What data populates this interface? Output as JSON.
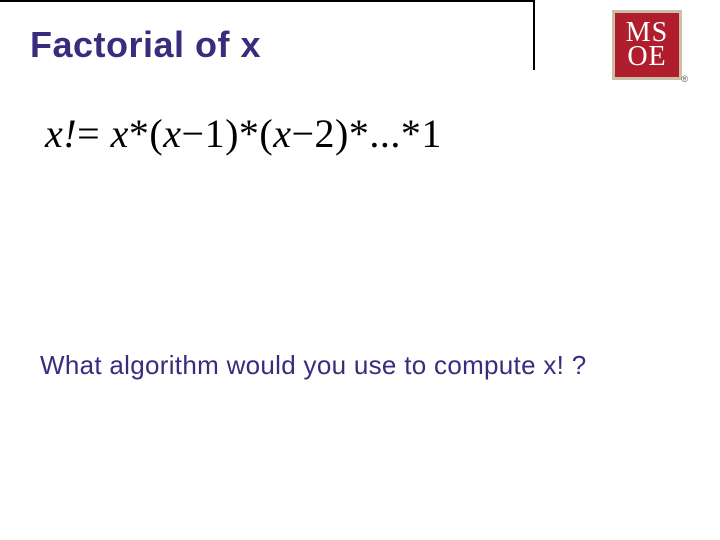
{
  "title": "Factorial of x",
  "logo": {
    "line1": "MS",
    "line2": "OE",
    "reg": "®"
  },
  "formula": {
    "lhs": "x!",
    "eq": "=",
    "t1": "x",
    "star": "*",
    "lp": "(",
    "rp": ")",
    "xm1_a": "x",
    "xm1_m": "−",
    "xm1_b": "1",
    "xm2_a": "x",
    "xm2_m": "−",
    "xm2_b": "2",
    "dots": "...",
    "one": "1"
  },
  "question": "What algorithm would you use to compute x! ?"
}
